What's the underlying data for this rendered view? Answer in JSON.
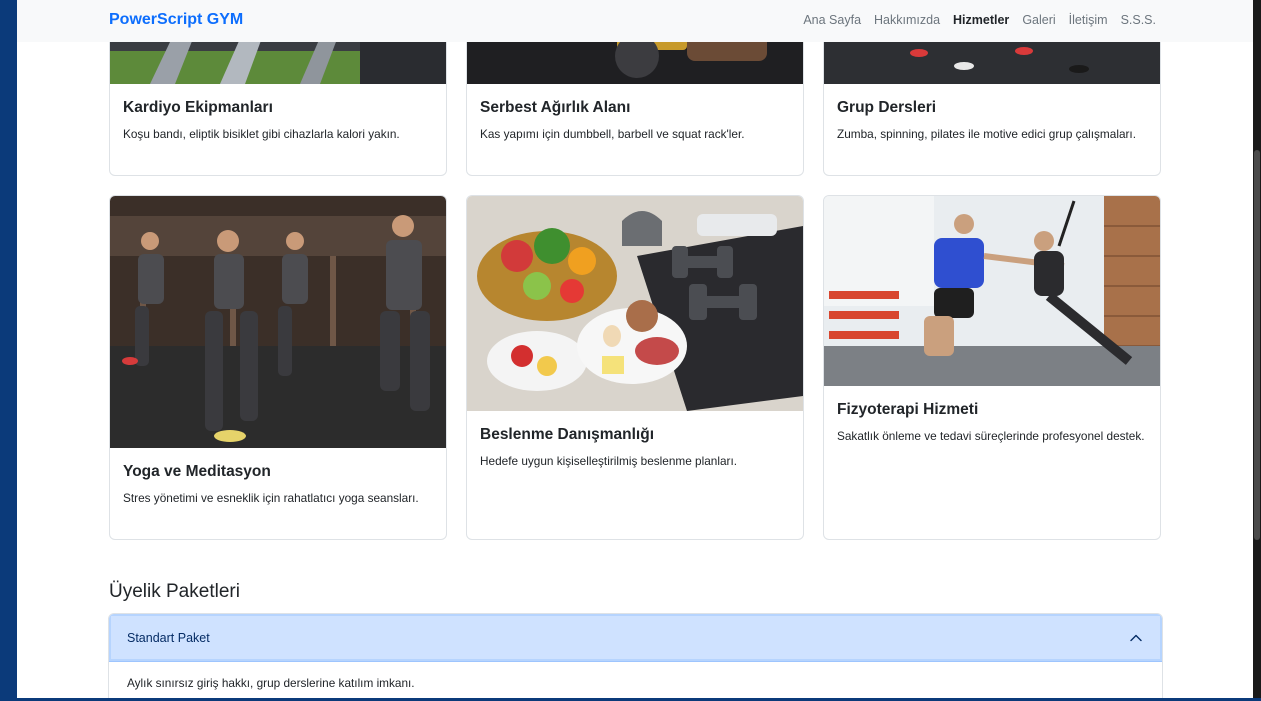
{
  "navbar": {
    "brand": "PowerScript GYM",
    "links": [
      "Ana Sayfa",
      "Hakkımızda",
      "Hizmetler",
      "Galeri",
      "İletişim",
      "S.S.S."
    ],
    "active": "Hizmetler"
  },
  "services": [
    {
      "title": "Kardiyo Ekipmanları",
      "text": "Koşu bandı, eliptik bisiklet gibi cihazlarla kalori yakın."
    },
    {
      "title": "Serbest Ağırlık Alanı",
      "text": "Kas yapımı için dumbbell, barbell ve squat rack'ler."
    },
    {
      "title": "Grup Dersleri",
      "text": "Zumba, spinning, pilates ile motive edici grup çalışmaları."
    },
    {
      "title": "Yoga ve Meditasyon",
      "text": "Stres yönetimi ve esneklik için rahatlatıcı yoga seansları."
    },
    {
      "title": "Beslenme Danışmanlığı",
      "text": "Hedefe uygun kişiselleştirilmiş beslenme planları."
    },
    {
      "title": "Fizyoterapi Hizmeti",
      "text": "Sakatlık önleme ve tedavi süreçlerinde profesyonel destek."
    }
  ],
  "membership": {
    "title": "Üyelik Paketleri",
    "packages": [
      {
        "name": "Standart Paket",
        "description": "Aylık sınırsız giriş hakkı, grup derslerine katılım imkanı.",
        "expanded": true
      }
    ]
  },
  "colors": {
    "brand": "#0d6efd",
    "accordion_active": "#cfe2ff",
    "page_frame": "#0b3a7a"
  },
  "icons": {
    "accordion_toggle": "chevron-up-icon"
  }
}
